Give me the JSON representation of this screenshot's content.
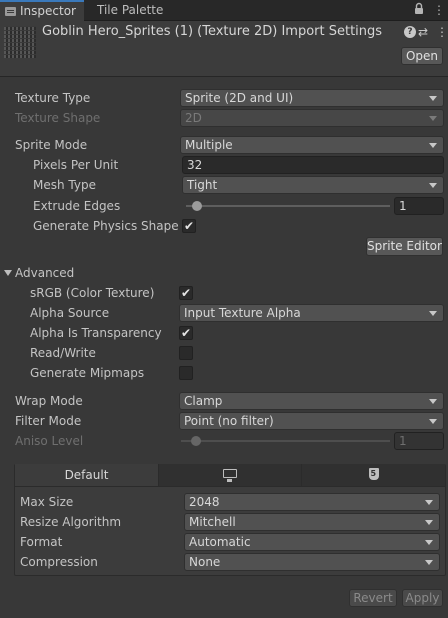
{
  "tabs": {
    "inspector": "Inspector",
    "tile_palette": "Tile Palette",
    "lock": "🔒",
    "more": "⋮"
  },
  "header": {
    "title": "Goblin Hero_Sprites (1) (Texture 2D) Import Settings",
    "help": "?",
    "settings": "⇄",
    "more": "⋮",
    "open_button": "Open"
  },
  "rows": {
    "texture_type": {
      "label": "Texture Type",
      "value": "Sprite (2D and UI)"
    },
    "texture_shape": {
      "label": "Texture Shape",
      "value": "2D"
    },
    "sprite_mode": {
      "label": "Sprite Mode",
      "value": "Multiple"
    },
    "pixels_per_unit": {
      "label": "Pixels Per Unit",
      "value": "32"
    },
    "mesh_type": {
      "label": "Mesh Type",
      "value": "Tight"
    },
    "extrude_edges": {
      "label": "Extrude Edges",
      "value": "1",
      "slider_fraction": 0.03
    },
    "generate_physics_shape": {
      "label": "Generate Physics Shape",
      "checked": "✔"
    },
    "sprite_editor_button": "Sprite Editor",
    "advanced": "Advanced",
    "srgb": {
      "label": "sRGB (Color Texture)",
      "checked": "✔"
    },
    "alpha_source": {
      "label": "Alpha Source",
      "value": "Input Texture Alpha"
    },
    "alpha_is_transparency": {
      "label": "Alpha Is Transparency",
      "checked": "✔"
    },
    "read_write": {
      "label": "Read/Write",
      "checked": ""
    },
    "generate_mipmaps": {
      "label": "Generate Mipmaps",
      "checked": ""
    },
    "wrap_mode": {
      "label": "Wrap Mode",
      "value": "Clamp"
    },
    "filter_mode": {
      "label": "Filter Mode",
      "value": "Point (no filter)"
    },
    "aniso_level": {
      "label": "Aniso Level",
      "value": "1",
      "slider_fraction": 0.05
    }
  },
  "platform": {
    "tabs": {
      "default": "Default",
      "standalone_icon": "monitor-icon",
      "webgl_icon": "html5-icon"
    },
    "max_size": {
      "label": "Max Size",
      "value": "2048"
    },
    "resize_algorithm": {
      "label": "Resize Algorithm",
      "value": "Mitchell"
    },
    "format": {
      "label": "Format",
      "value": "Automatic"
    },
    "compression": {
      "label": "Compression",
      "value": "None"
    }
  },
  "footer": {
    "revert": "Revert",
    "apply": "Apply"
  },
  "colors": {
    "background": "#383838",
    "active_tab_accent": "#3a79bb",
    "field": "#515151"
  }
}
